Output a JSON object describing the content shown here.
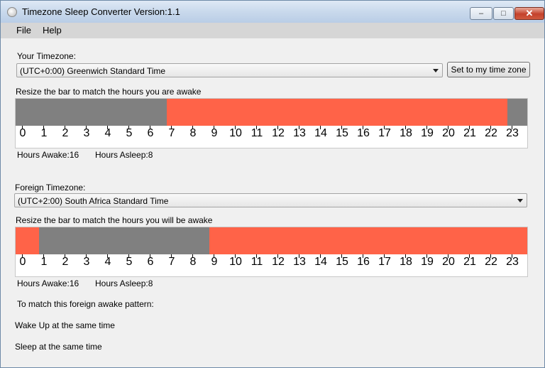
{
  "window": {
    "title": "Timezone Sleep Converter Version:1.1",
    "minimize_glyph": "–",
    "maximize_glyph": "□",
    "close_glyph": "✕"
  },
  "menu": {
    "file": "File",
    "help": "Help"
  },
  "your_tz": {
    "label": "Your Timezone:",
    "selected": "(UTC+0:00) Greenwich Standard Time",
    "set_button": "Set to my time zone",
    "bar_label": "Resize the bar to match the hours you are awake",
    "awake_text": "Hours Awake:16",
    "asleep_text": "Hours Asleep:8",
    "awake_start_hour": 6.8,
    "awake_end_hour": 22.8,
    "hours": [
      "0",
      "1",
      "2",
      "3",
      "4",
      "5",
      "6",
      "7",
      "8",
      "9",
      "10",
      "11",
      "12",
      "13",
      "14",
      "15",
      "16",
      "17",
      "18",
      "19",
      "20",
      "21",
      "22",
      "23"
    ]
  },
  "foreign_tz": {
    "label": "Foreign Timezone:",
    "selected": "(UTC+2:00) South Africa Standard Time",
    "bar_label": "Resize the bar to match the hours you will be awake",
    "awake_text": "Hours Awake:16",
    "asleep_text": "Hours Asleep:8",
    "awake_start_hour": 8.8,
    "awake_wrap_end_hour": 0.8,
    "hours": [
      "0",
      "1",
      "2",
      "3",
      "4",
      "5",
      "6",
      "7",
      "8",
      "9",
      "10",
      "11",
      "12",
      "13",
      "14",
      "15",
      "16",
      "17",
      "18",
      "19",
      "20",
      "21",
      "22",
      "23"
    ]
  },
  "advice": {
    "heading": "To match this foreign awake pattern:",
    "wake": "Wake Up at the same time",
    "sleep": "Sleep at the same time"
  },
  "colors": {
    "awake": "#ff6348",
    "asleep": "#808080"
  }
}
